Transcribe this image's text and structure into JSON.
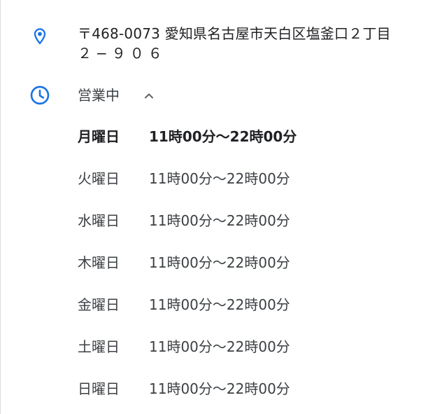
{
  "address": {
    "icon": "map-pin-icon",
    "line1": "〒468-0073 愛知県名古屋市天白区塩釜口２丁目",
    "line2": "２−９０６"
  },
  "hours": {
    "icon": "clock-icon",
    "status": "営業中",
    "toggle_icon": "chevron-up-icon",
    "accent_color": "#1a73e8",
    "rows": [
      {
        "day": "月曜日",
        "time": "11時00分～22時00分"
      },
      {
        "day": "火曜日",
        "time": "11時00分～22時00分"
      },
      {
        "day": "水曜日",
        "time": "11時00分～22時00分"
      },
      {
        "day": "木曜日",
        "time": "11時00分～22時00分"
      },
      {
        "day": "金曜日",
        "time": "11時00分～22時00分"
      },
      {
        "day": "土曜日",
        "time": "11時00分～22時00分"
      },
      {
        "day": "日曜日",
        "time": "11時00分～22時00分"
      }
    ]
  }
}
